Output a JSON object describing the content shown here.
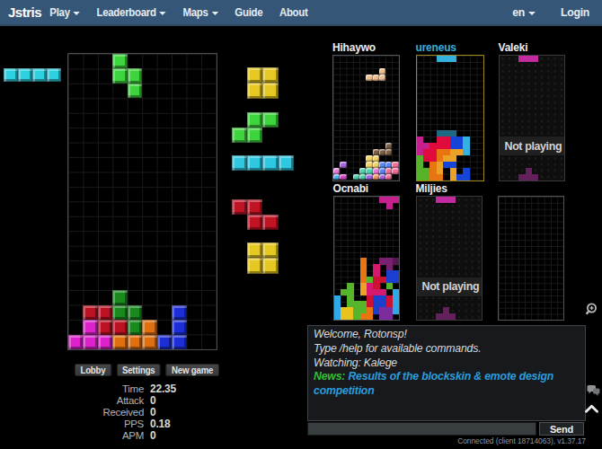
{
  "navbar": {
    "brand": "Jstris",
    "items": [
      {
        "label": "Play",
        "caret": true
      },
      {
        "label": "Leaderboard",
        "caret": true
      },
      {
        "label": "Maps",
        "caret": true
      },
      {
        "label": "Guide",
        "caret": false
      },
      {
        "label": "About",
        "caret": false
      }
    ],
    "right_items": [
      {
        "label": "en",
        "caret": true
      },
      {
        "label": "Login",
        "caret": false
      }
    ]
  },
  "game": {
    "hold": {
      "piece": "I",
      "palette": {
        "C": "#2fd0e2"
      },
      "cells": [
        "CCCC"
      ]
    },
    "main_board": {
      "palette": {
        "G": "#3ed43e",
        "g": "#1a8a1f",
        "R": "#bb1122",
        "M": "#dd22cc",
        "O": "#e0700f",
        "B": "#1c2ed6",
        "C": "#2ec9e0",
        "Y": "#e6c822"
      },
      "cells": [
        "...G......",
        "...GG.....",
        "....G.....",
        "..........",
        "..........",
        "..........",
        "..........",
        "..........",
        "..........",
        "..........",
        "..........",
        "..........",
        "..........",
        "..........",
        "..........",
        "..........",
        "...g......",
        ".RRgg..B..",
        ".MRRgO.B..",
        "MMMOOOBB.."
      ]
    },
    "queue": {
      "palette": {
        "Y": "#e6c822",
        "G": "#3ed43e",
        "C": "#2ec9e0",
        "R": "#c01425"
      },
      "pieces": [
        {
          "name": "O",
          "cells": [
            ".YY.",
            ".YY."
          ]
        },
        {
          "name": "S",
          "cells": [
            ".GG",
            "GG."
          ]
        },
        {
          "name": "I",
          "cells": [
            "CCCC"
          ]
        },
        {
          "name": "Z",
          "cells": [
            "RR.",
            ".RR"
          ]
        },
        {
          "name": "O",
          "cells": [
            ".YY.",
            ".YY."
          ]
        }
      ]
    },
    "buttons": [
      {
        "label": "Lobby"
      },
      {
        "label": "Settings"
      },
      {
        "label": "New game"
      }
    ],
    "stats": [
      {
        "label": "Time",
        "value": "22.35"
      },
      {
        "label": "Attack",
        "value": "0"
      },
      {
        "label": "Received",
        "value": "0"
      },
      {
        "label": "PPS",
        "value": "0.18"
      },
      {
        "label": "APM",
        "value": "0"
      }
    ]
  },
  "players": [
    {
      "name": "Hihaywo",
      "state": "playing",
      "skin": "candy",
      "grid": "lines",
      "palette": {
        "N": "#ecbd8d",
        "n": "#7e5f45",
        "Y": "#f2d264",
        "U": "#a965e2",
        "P": "#ea7ad8",
        "B": "#5b85f0",
        "R": "#ef6f95",
        "T": "#57cfae",
        "O": "#f29a5e",
        "M": "#d946c8",
        "L": "#52b3f2"
      },
      "cells": [
        "..........",
        "..........",
        ".......N..",
        ".....NNN..",
        "..........",
        "..........",
        "..........",
        "..........",
        "..........",
        "..........",
        "..........",
        "..........",
        "..........",
        "..........",
        "........n.",
        "......nnn.",
        ".....YY...",
        ".U...YYBBR",
        "P...TTPBRR",
        "LM.TTUOUR."
      ]
    },
    {
      "name": "ureneus",
      "state": "watched",
      "skin": "flat",
      "grid": "lines",
      "palette": {
        "T": "#1d6a82",
        "M": "#c4208e",
        "R": "#e00a3c",
        "B": "#1545d8",
        "C": "#35b1e0",
        "O": "#e87511",
        "A": "#eca227",
        "G": "#55b229"
      },
      "cells": [
        "...CCC....",
        "..........",
        "..........",
        "..........",
        "..........",
        "..........",
        "..........",
        "..........",
        "..........",
        "..........",
        "..........",
        "..........",
        "...TTT....",
        "M..RRBBC..",
        "MMRRRBBC..",
        "MRROOAAC..",
        "GRROAA....",
        "G.OABB....",
        "GGOA.A.B..",
        "GGOO.ABB.."
      ]
    },
    {
      "name": "Valeki",
      "state": "not_playing",
      "overlay": "Not playing",
      "skin": "flat",
      "grid": "dots",
      "palette": {
        "M": "#c22b9e",
        "d": "#63205c"
      },
      "cells": [
        "...MMM....",
        "..........",
        "..........",
        "..........",
        "..........",
        "..........",
        "..........",
        "..........",
        "..........",
        "..........",
        "..........",
        "..........",
        "..........",
        "..........",
        "..........",
        "..........",
        "..........",
        "..........",
        "....d.....",
        "...ddd...."
      ]
    },
    {
      "name": "Ocnabi",
      "state": "playing",
      "skin": "flat",
      "grid": "lines",
      "palette": {
        "M": "#d6186e",
        "U": "#7a2070",
        "u": "#55184f",
        "O": "#e87511",
        "A": "#eca227",
        "R": "#cc1133",
        "B": "#1d3fd0",
        "G": "#57b52b",
        "C": "#2fa8e8",
        "Y": "#e8c21d",
        "P": "#7b2d9e",
        "T": "#c4208e"
      },
      "cells": [
        ".......TTT",
        "........T.",
        "..........",
        "..........",
        "..........",
        "..........",
        "..........",
        "..........",
        "..........",
        "..........",
        "....O..UUu",
        "....O.M.U.",
        "....O.M.BB",
        "....OGRRBB",
        "..G.AMR.G.",
        ".GG.AMMM.C",
        "C.G..RBBRC",
        "C.GGGRBBRC",
        "CYYGGOBPPC",
        "CYYGOO.PP."
      ]
    },
    {
      "name": "Miljies",
      "state": "not_playing",
      "overlay": "Not playing",
      "skin": "flat",
      "grid": "dots",
      "palette": {
        "M": "#c22b9e",
        "d": "#63205c"
      },
      "cells": [
        "...MMM....",
        "..........",
        "..........",
        "..........",
        "..........",
        "..........",
        "..........",
        "..........",
        "..........",
        "..........",
        "..........",
        "..........",
        "..........",
        "..........",
        "..........",
        "..........",
        "..........",
        "..........",
        "....d.....",
        "...ddd...."
      ]
    },
    {
      "name": "",
      "state": "empty",
      "skin": "flat",
      "grid": "lines",
      "palette": {},
      "cells": []
    }
  ],
  "chat": {
    "messages": [
      {
        "type": "info",
        "text": "Welcome, Rotonsp!"
      },
      {
        "type": "info",
        "text": "Type /help for available commands."
      },
      {
        "type": "info",
        "text": "Watching: Kalege"
      },
      {
        "type": "news",
        "prefix": "News:",
        "text": "Results of the blockskin & emote design competition"
      }
    ],
    "input_value": "",
    "send_label": "Send"
  },
  "status_bar": {
    "text": "Connected (client 18714063), v1.37.17"
  },
  "colors": {
    "navbar_bg": "#365677",
    "watched_border": "#9c861c",
    "board_border": "#515558",
    "dim_board_border": "#3a3a3a",
    "news_green": "#33bd33",
    "link_blue": "#2b9cdb"
  }
}
